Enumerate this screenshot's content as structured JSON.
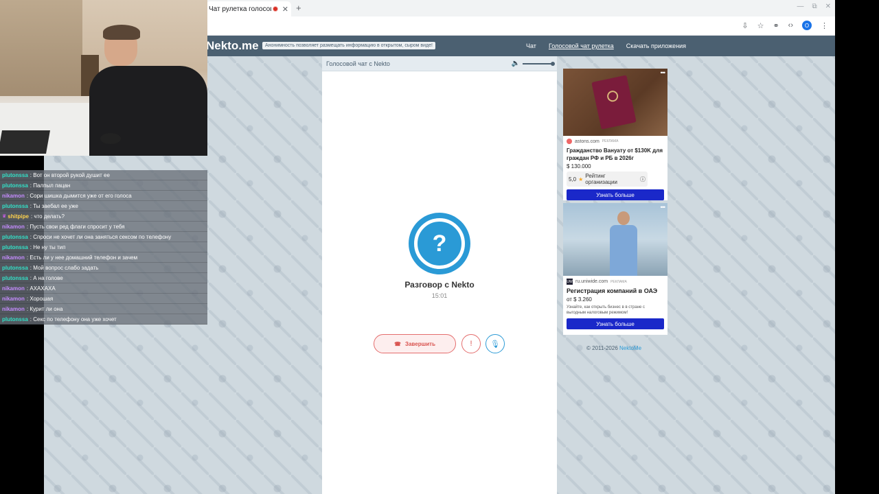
{
  "browser": {
    "tab_title": "Чат рулетка голосов",
    "tab_close": "✕",
    "new_tab": "+",
    "win_min": "—",
    "win_max": "⧉",
    "win_close": "✕",
    "profile_initial": "O"
  },
  "site": {
    "logo": "Nekto.me",
    "anon_note": "Анонимность позволяет размещать информацию в открытом, сыром виде!",
    "nav": [
      "Чат",
      "Голосовой чат рулетка",
      "Скачать приложения"
    ]
  },
  "chat": {
    "header_title": "Голосовой чат с Nekto",
    "volume_icon": "🔈",
    "avatar_symbol": "?",
    "conversation_title": "Разговор с Nekto",
    "timer": "15:01",
    "end_label": "Завершить",
    "end_icon": "☎",
    "shield_icon": "!",
    "mic_icon": "🎙",
    "volume_level": 1.0
  },
  "ads": [
    {
      "source": "astons.com",
      "tag": "Реклама",
      "title": "Гражданство Вануату от $130K для граждан РФ и РБ в 2026г",
      "price": "$ 130.000",
      "rating": "5,0",
      "rating_label": "Рейтинг организации",
      "button": "Узнать больше",
      "dots": "•••"
    },
    {
      "source": "ru.uniwide.com",
      "source_icon": "UW",
      "tag": "Реклама",
      "title": "Регистрация компаний в ОАЭ",
      "price": "от $ 3.260",
      "desc": "Узнайте, как открыть бизнес в в стране с выгодным налоговым режимом!",
      "button": "Узнать больше",
      "dots": "•••"
    }
  ],
  "footer": {
    "copyright": "© 2011-2026 ",
    "link": "NektoMe"
  },
  "stream_chat": [
    {
      "user": "plutonssa",
      "text": ": Вот он второй рукой душит ее",
      "color": "pl"
    },
    {
      "user": "plutonssa",
      "text": ": Палпыл пацан",
      "color": "pl"
    },
    {
      "user": "nikamon",
      "text": ": Сори шишка дымится уже от его голоса",
      "color": "ni"
    },
    {
      "user": "plutonssa",
      "text": ": Ты заебал ее уже",
      "color": "pl"
    },
    {
      "user": "shitpipe",
      "text": ": что делать?",
      "color": "sh",
      "badge": "♛"
    },
    {
      "user": "nikamon",
      "text": ": Пусть свои ред флаги спросит у тебя",
      "color": "ni"
    },
    {
      "user": "plutonssa",
      "text": ": Спроси не хочет ли она заняться сексом по телефону",
      "color": "pl"
    },
    {
      "user": "plutonssa",
      "text": ": Не ну ты тип",
      "color": "pl"
    },
    {
      "user": "nikamon",
      "text": ": Есть ли у нее домашний телефон и зачем",
      "color": "ni"
    },
    {
      "user": "plutonssa",
      "text": ": Мой вопрос слабо задать",
      "color": "pl"
    },
    {
      "user": "plutonssa",
      "text": ": А на голове",
      "color": "pl"
    },
    {
      "user": "nikamon",
      "text": ": АХАХАХА",
      "color": "ni"
    },
    {
      "user": "nikamon",
      "text": ": Хорошая",
      "color": "ni"
    },
    {
      "user": "nikamon",
      "text": ": Курит ли она",
      "color": "ni"
    },
    {
      "user": "plutonssa",
      "text": ": Секс по телефону она уже хочет",
      "color": "pl"
    }
  ]
}
